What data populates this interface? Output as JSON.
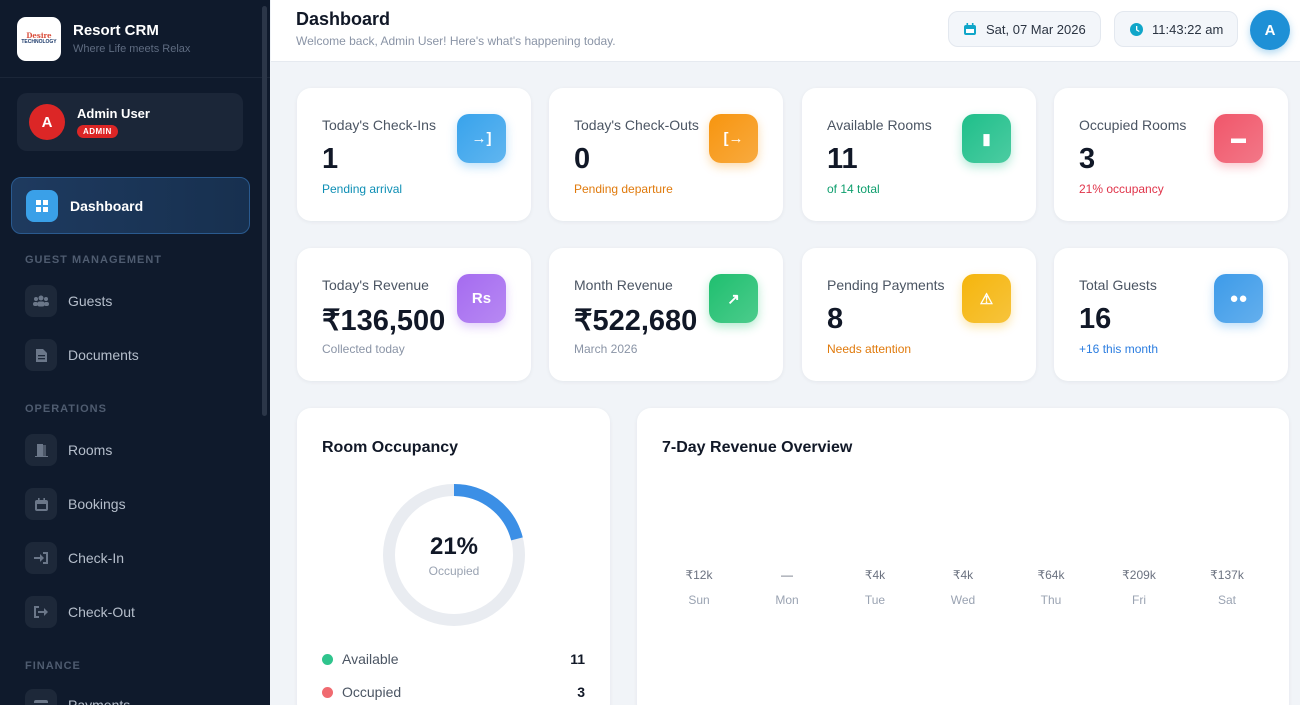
{
  "brand": {
    "title": "Resort CRM",
    "subtitle": "Where Life meets Relax",
    "logo_line1": "Desire",
    "logo_line2": "TECHNOLOGY"
  },
  "user": {
    "initial": "A",
    "name": "Admin User",
    "role": "ADMIN"
  },
  "nav": {
    "active": {
      "label": "Dashboard",
      "icon": "dashboard-icon"
    },
    "sections": [
      {
        "title": "GUEST MANAGEMENT",
        "items": [
          {
            "label": "Guests",
            "icon": "users-icon"
          },
          {
            "label": "Documents",
            "icon": "document-icon"
          }
        ]
      },
      {
        "title": "OPERATIONS",
        "items": [
          {
            "label": "Rooms",
            "icon": "door-icon"
          },
          {
            "label": "Bookings",
            "icon": "calendar-icon"
          },
          {
            "label": "Check-In",
            "icon": "sign-in-icon"
          },
          {
            "label": "Check-Out",
            "icon": "sign-out-icon"
          }
        ]
      },
      {
        "title": "FINANCE",
        "items": [
          {
            "label": "Payments",
            "icon": "payments-icon"
          }
        ]
      }
    ]
  },
  "header": {
    "title": "Dashboard",
    "subtitle": "Welcome back, Admin User! Here's what's happening today.",
    "date": "Sat, 07 Mar 2026",
    "time": "11:43:22 am",
    "avatar_initial": "A"
  },
  "stats": [
    {
      "label": "Today's Check-Ins",
      "value": "1",
      "sub": "Pending arrival",
      "sub_color": "#0e8fb5",
      "icon": "sign-in-icon",
      "glyph": "→]",
      "color": "#38a3ec"
    },
    {
      "label": "Today's Check-Outs",
      "value": "0",
      "sub": "Pending departure",
      "sub_color": "#e07a0c",
      "icon": "sign-out-icon",
      "glyph": "[→",
      "color": "#f7950f"
    },
    {
      "label": "Available Rooms",
      "value": "11",
      "sub": "of 14 total",
      "sub_color": "#0f9f6e",
      "icon": "door-open-icon",
      "glyph": "▮",
      "color": "#1fbf8a"
    },
    {
      "label": "Occupied Rooms",
      "value": "3",
      "sub": "21% occupancy",
      "sub_color": "#e0344a",
      "icon": "bed-icon",
      "glyph": "▬",
      "color": "#f0566a"
    },
    {
      "label": "Today's Revenue",
      "value": "₹136,500",
      "sub": "Collected today",
      "sub_color": "#8a94a6",
      "icon": "rupee-icon",
      "glyph": "Rs",
      "color": "#a56bf0"
    },
    {
      "label": "Month Revenue",
      "value": "₹522,680",
      "sub": "March 2026",
      "sub_color": "#8a94a6",
      "icon": "chart-line-icon",
      "glyph": "↗",
      "color": "#1fbf6f"
    },
    {
      "label": "Pending Payments",
      "value": "8",
      "sub": "Needs attention",
      "sub_color": "#e07a0c",
      "icon": "warning-icon",
      "glyph": "⚠",
      "color": "#f5b50c"
    },
    {
      "label": "Total Guests",
      "value": "16",
      "sub": "+16 this month",
      "sub_color": "#2b7de0",
      "icon": "users-icon",
      "glyph": "●●",
      "color": "#3d9be9"
    }
  ],
  "occupancy": {
    "title": "Room Occupancy",
    "percent_label": "21%",
    "percent": 21,
    "center_label": "Occupied",
    "legend": [
      {
        "label": "Available",
        "value": "11",
        "color": "#2fc48d"
      },
      {
        "label": "Occupied",
        "value": "3",
        "color": "#f06a70"
      }
    ]
  },
  "revenue": {
    "title": "7-Day Revenue Overview",
    "chart_data": {
      "type": "bar",
      "categories": [
        "Sun",
        "Mon",
        "Tue",
        "Wed",
        "Thu",
        "Fri",
        "Sat"
      ],
      "value_labels": [
        "₹12k",
        "—",
        "₹4k",
        "₹4k",
        "₹64k",
        "₹209k",
        "₹137k"
      ],
      "values": [
        12,
        0,
        4,
        4,
        64,
        209,
        137
      ]
    }
  }
}
